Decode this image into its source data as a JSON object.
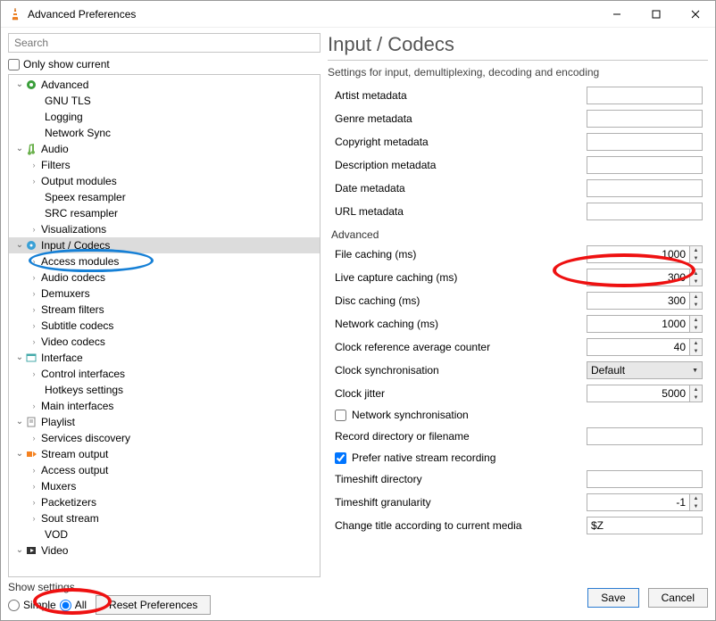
{
  "window": {
    "title": "Advanced Preferences"
  },
  "search": {
    "placeholder": "Search"
  },
  "only_current_label": "Only show current",
  "tree": {
    "advanced": "Advanced",
    "gnu_tls": "GNU TLS",
    "logging": "Logging",
    "network_sync": "Network Sync",
    "audio": "Audio",
    "filters": "Filters",
    "output_modules": "Output modules",
    "speex": "Speex resampler",
    "src": "SRC resampler",
    "visualizations": "Visualizations",
    "input_codecs": "Input / Codecs",
    "access_modules": "Access modules",
    "audio_codecs": "Audio codecs",
    "demuxers": "Demuxers",
    "stream_filters": "Stream filters",
    "subtitle_codecs": "Subtitle codecs",
    "video_codecs": "Video codecs",
    "interface": "Interface",
    "control_interfaces": "Control interfaces",
    "hotkeys": "Hotkeys settings",
    "main_interfaces": "Main interfaces",
    "playlist": "Playlist",
    "services_discovery": "Services discovery",
    "stream_output": "Stream output",
    "access_output": "Access output",
    "muxers": "Muxers",
    "packetizers": "Packetizers",
    "sout_stream": "Sout stream",
    "vod": "VOD",
    "video": "Video"
  },
  "panel": {
    "heading": "Input / Codecs",
    "caption": "Settings for input, demultiplexing, decoding and encoding",
    "fields": {
      "artist": "Artist metadata",
      "genre": "Genre metadata",
      "copyright": "Copyright metadata",
      "description": "Description metadata",
      "date": "Date metadata",
      "url": "URL metadata"
    },
    "advanced_h": "Advanced",
    "adv": {
      "file_caching": {
        "label": "File caching (ms)",
        "value": "1000"
      },
      "live_caching": {
        "label": "Live capture caching (ms)",
        "value": "300"
      },
      "disc_caching": {
        "label": "Disc caching (ms)",
        "value": "300"
      },
      "network_caching": {
        "label": "Network caching (ms)",
        "value": "1000"
      },
      "clock_ref": {
        "label": "Clock reference average counter",
        "value": "40"
      },
      "clock_sync": {
        "label": "Clock synchronisation",
        "value": "Default"
      },
      "clock_jitter": {
        "label": "Clock jitter",
        "value": "5000"
      },
      "net_sync": {
        "label": "Network synchronisation"
      },
      "record_dir": {
        "label": "Record directory or filename"
      },
      "prefer_native": {
        "label": "Prefer native stream recording"
      },
      "timeshift_dir": {
        "label": "Timeshift directory"
      },
      "timeshift_gran": {
        "label": "Timeshift granularity",
        "value": "-1"
      },
      "change_title": {
        "label": "Change title according to current media",
        "value": "$Z"
      }
    }
  },
  "footer": {
    "show_settings": "Show settings",
    "simple": "Simple",
    "all": "All",
    "reset": "Reset Preferences",
    "save": "Save",
    "cancel": "Cancel"
  }
}
